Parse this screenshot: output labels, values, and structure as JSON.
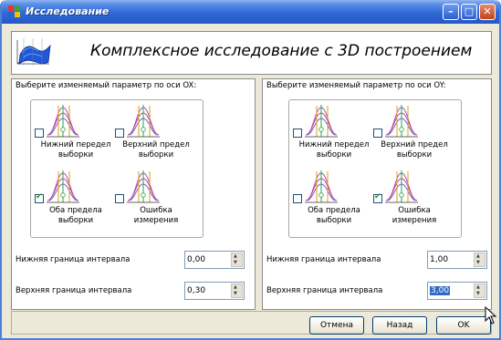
{
  "window": {
    "title": "Исследование"
  },
  "header": {
    "title": "Комплексное исследование с 3D построением"
  },
  "x_panel": {
    "label": "Выберите изменяемый параметр по оси OX:",
    "options": [
      {
        "label1": "Нижний передел",
        "label2": "выборки",
        "checked": false
      },
      {
        "label1": "Верхний предел",
        "label2": "выборки",
        "checked": false
      },
      {
        "label1": "Оба предела",
        "label2": "выборки",
        "checked": true
      },
      {
        "label1": "Ошибка",
        "label2": "измерения",
        "checked": false
      }
    ],
    "lower_label": "Нижняя граница интервала",
    "lower_value": "0,00",
    "upper_label": "Верхняя граница интервала",
    "upper_value": "0,30"
  },
  "y_panel": {
    "label": "Выберите изменяемый параметр по оси OY:",
    "options": [
      {
        "label1": "Нижний передел",
        "label2": "выборки",
        "checked": false
      },
      {
        "label1": "Верхний предел",
        "label2": "выборки",
        "checked": false
      },
      {
        "label1": "Оба предела",
        "label2": "выборки",
        "checked": false
      },
      {
        "label1": "Ошибка",
        "label2": "измерения",
        "checked": true
      }
    ],
    "lower_label": "Нижняя граница интервала",
    "lower_value": "1,00",
    "upper_label": "Верхняя граница интервала",
    "upper_value": "3,00"
  },
  "thumb_text": {
    "xcp": "Xcp",
    "xh": "Xн",
    "xv": "Xв",
    "g": "G"
  },
  "buttons": {
    "cancel": "Отмена",
    "back": "Назад",
    "ok": "OK"
  },
  "colors": {
    "titlebar": "#2f68d6",
    "close": "#c4431c",
    "check": "#21a121",
    "selection": "#316ac5"
  }
}
